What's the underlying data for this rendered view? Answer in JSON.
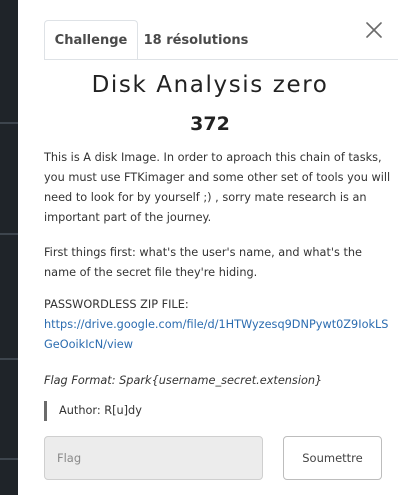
{
  "tabs": {
    "challenge": "Challenge",
    "solves": "18 résolutions"
  },
  "challenge": {
    "name": "Disk Analysis zero",
    "points": "372",
    "description_p1": "This is A disk Image. In order to aproach this chain of tasks, you must use FTKimager and some other set of tools you will need to look for by yourself ;) , sorry mate research is an important part of the journey.",
    "description_p2": "First things first: what's the user's name, and what's the name of the secret file they're hiding.",
    "zip_label": "PASSWORDLESS ZIP FILE:",
    "zip_link": "https://drive.google.com/file/d/1HTWyzesq9DNPywt0Z9IokLSGeOoikIcN/view",
    "flag_format": "Flag Format: Spark{username_secret.extension}",
    "author": "Author: R[u]dy"
  },
  "form": {
    "flag_placeholder": "Flag",
    "submit_label": "Soumettre"
  },
  "icons": {
    "close": "close-icon"
  }
}
